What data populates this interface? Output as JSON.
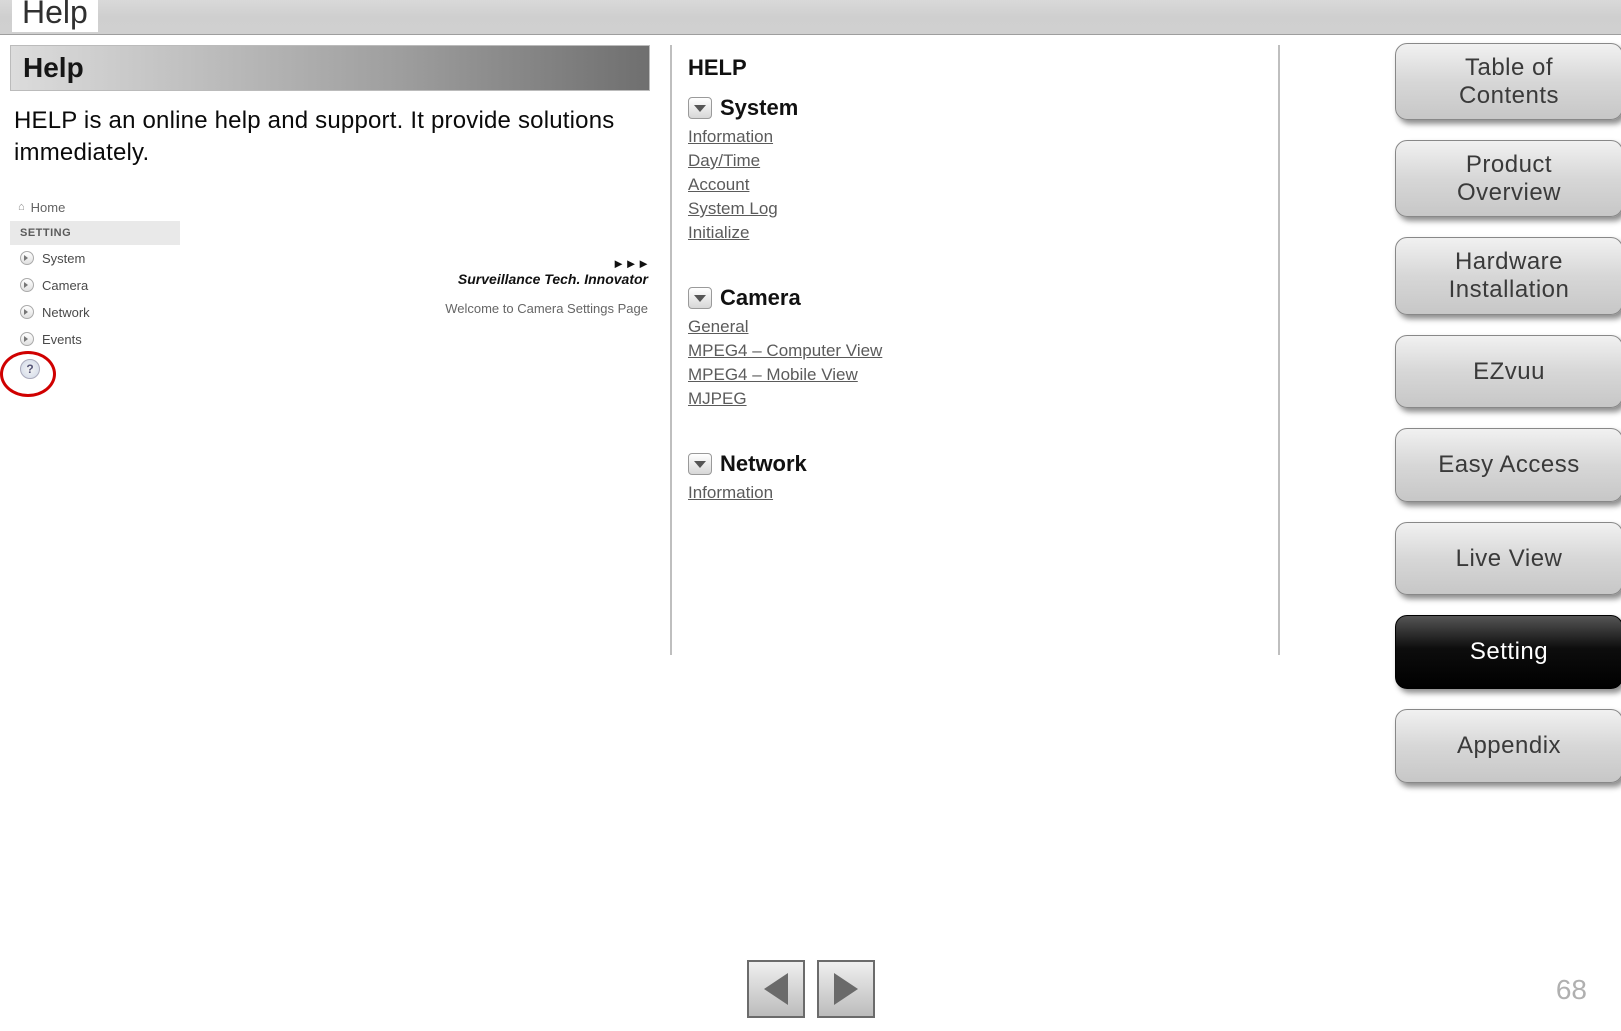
{
  "page": {
    "title": "Help",
    "number": "68"
  },
  "left": {
    "section_header": "Help",
    "description": "HELP is an online help and support. It provide solutions immediately.",
    "mini": {
      "home": "Home",
      "setting_header": "SETTING",
      "items": [
        "System",
        "Camera",
        "Network",
        "Events"
      ],
      "brand": "Surveillance Tech. Innovator",
      "welcome": "Welcome to Camera Settings Page"
    }
  },
  "mid": {
    "title": "HELP",
    "sections": [
      {
        "name": "System",
        "links": [
          "Information",
          "Day/Time",
          "Account",
          "System Log",
          "Initialize"
        ]
      },
      {
        "name": "Camera",
        "links": [
          "General",
          "MPEG4 – Computer View",
          "MPEG4 – Mobile View",
          "MJPEG"
        ]
      },
      {
        "name": "Network",
        "links": [
          "Information"
        ]
      }
    ]
  },
  "nav": [
    {
      "label": "Table of Contents",
      "lines": 2,
      "active": false
    },
    {
      "label": "Product Overview",
      "lines": 2,
      "active": false
    },
    {
      "label": "Hardware Installation",
      "lines": 2,
      "active": false
    },
    {
      "label": "EZvuu",
      "lines": 1,
      "active": false
    },
    {
      "label": "Easy Access",
      "lines": 1,
      "active": false
    },
    {
      "label": "Live View",
      "lines": 1,
      "active": false
    },
    {
      "label": "Setting",
      "lines": 1,
      "active": true
    },
    {
      "label": "Appendix",
      "lines": 1,
      "active": false
    }
  ]
}
